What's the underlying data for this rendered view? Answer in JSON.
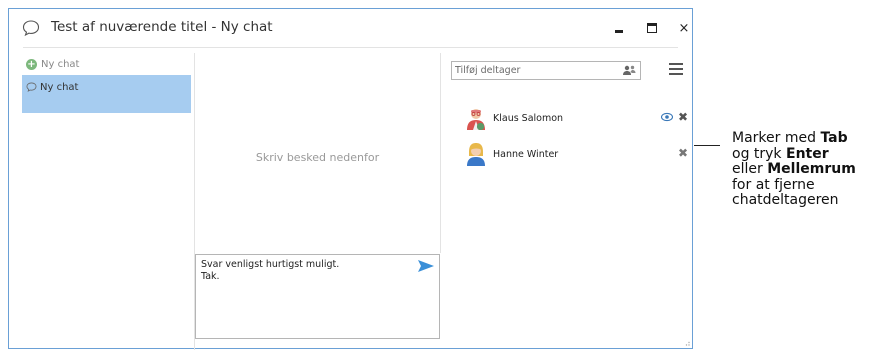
{
  "window": {
    "title": "Test af nuværende titel - Ny chat",
    "minimize_glyph": "",
    "close_glyph": "×"
  },
  "sidebar": {
    "new_chat_label": "Ny chat",
    "items": [
      {
        "label": "Ny chat",
        "selected": true
      }
    ]
  },
  "messages": {
    "placeholder": "Skriv besked nedenfor"
  },
  "compose": {
    "text": "Svar venligst hurtigst muligt.\nTak."
  },
  "participants_panel": {
    "add_placeholder": "Tilføj deltager",
    "participants": [
      {
        "name": "Klaus Salomon",
        "icons": [
          "eye-icon",
          "remove-icon"
        ]
      },
      {
        "name": "Hanne Winter",
        "icons": [
          "remove-icon"
        ]
      }
    ]
  },
  "callout": {
    "line1_prefix": "Marker med ",
    "line1_key": "Tab",
    "line2_prefix": "og tryk ",
    "line2_key": "Enter",
    "line3_prefix": "eller ",
    "line3_key": "Mellemrum",
    "line4": "for at fjerne",
    "line5": "chatdeltageren"
  },
  "colors": {
    "selection": "#a6ccf0",
    "window_border": "#6aa0d6",
    "send_accent": "#3a8fd8",
    "plus_green": "#7db87d"
  }
}
